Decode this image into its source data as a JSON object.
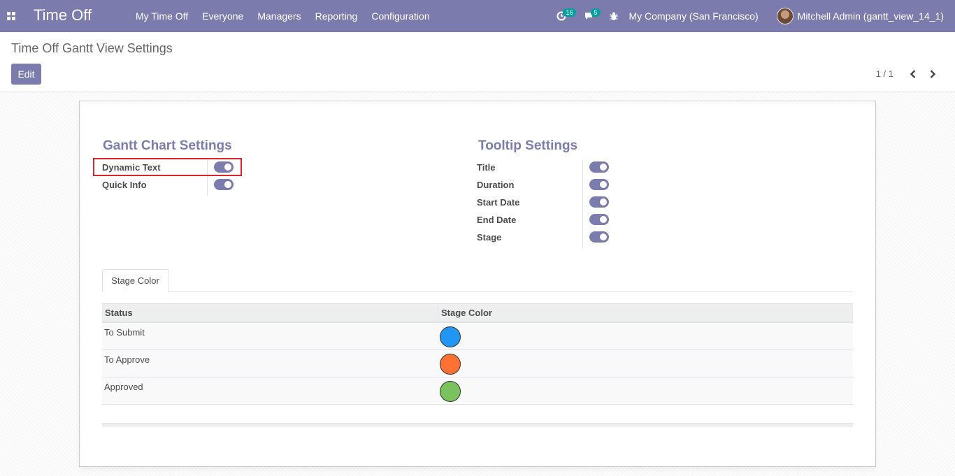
{
  "app": {
    "title": "Time Off",
    "menu": [
      "My Time Off",
      "Everyone",
      "Managers",
      "Reporting",
      "Configuration"
    ],
    "activity_count": "16",
    "message_count": "5",
    "company": "My Company (San Francisco)",
    "user": "Mitchell Admin (gantt_view_14_1)"
  },
  "control_panel": {
    "breadcrumb": "Time Off Gantt View Settings",
    "edit_label": "Edit",
    "pager": "1 / 1"
  },
  "gantt_settings": {
    "title": "Gantt Chart Settings",
    "fields": [
      {
        "label": "Dynamic Text",
        "enabled": true
      },
      {
        "label": "Quick Info",
        "enabled": true
      }
    ]
  },
  "tooltip_settings": {
    "title": "Tooltip Settings",
    "fields": [
      {
        "label": "Title",
        "enabled": true
      },
      {
        "label": "Duration",
        "enabled": true
      },
      {
        "label": "Start Date",
        "enabled": true
      },
      {
        "label": "End Date",
        "enabled": true
      },
      {
        "label": "Stage",
        "enabled": true
      }
    ]
  },
  "tabs": [
    {
      "label": "Stage Color",
      "active": true
    }
  ],
  "stage_table": {
    "headers": [
      "Status",
      "Stage Color"
    ],
    "rows": [
      {
        "status": "To Submit",
        "color": "#2196f3"
      },
      {
        "status": "To Approve",
        "color": "#ff7132"
      },
      {
        "status": "Approved",
        "color": "#79c25e"
      }
    ]
  },
  "colors": {
    "navbar": "#7c7bad",
    "accent": "#7c7bad",
    "badge": "#00a09d",
    "highlight": "#d9262c"
  }
}
